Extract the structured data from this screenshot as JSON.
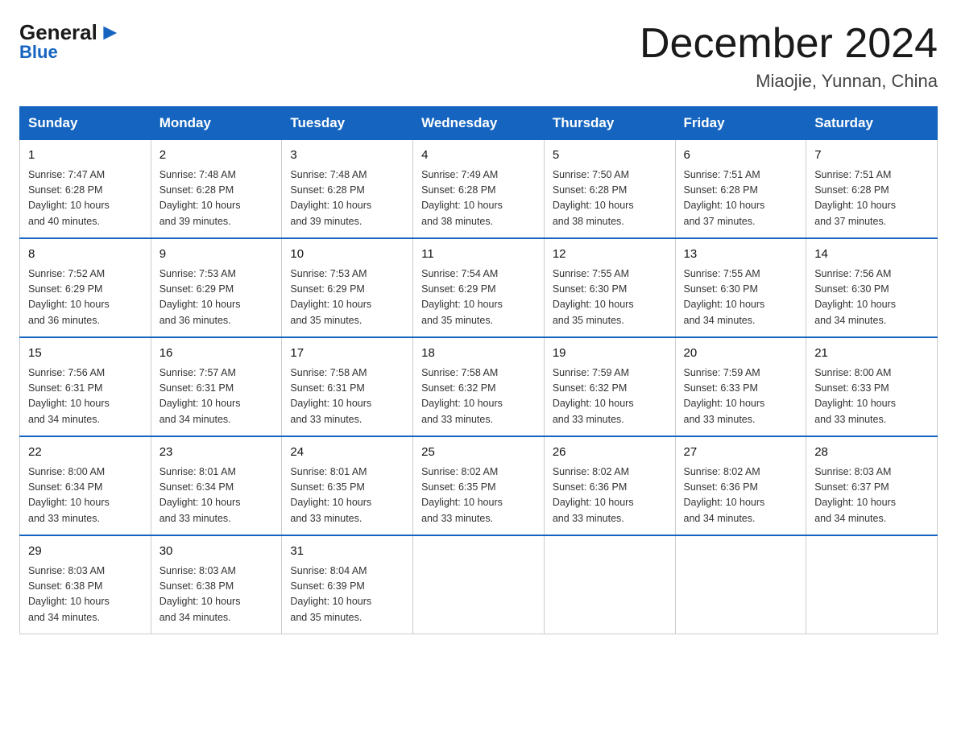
{
  "logo": {
    "general": "General",
    "blue": "Blue",
    "tagline": "Blue"
  },
  "title": {
    "month_year": "December 2024",
    "location": "Miaojie, Yunnan, China"
  },
  "days_of_week": [
    "Sunday",
    "Monday",
    "Tuesday",
    "Wednesday",
    "Thursday",
    "Friday",
    "Saturday"
  ],
  "weeks": [
    [
      {
        "day": "1",
        "sunrise": "7:47 AM",
        "sunset": "6:28 PM",
        "daylight": "10 hours and 40 minutes."
      },
      {
        "day": "2",
        "sunrise": "7:48 AM",
        "sunset": "6:28 PM",
        "daylight": "10 hours and 39 minutes."
      },
      {
        "day": "3",
        "sunrise": "7:48 AM",
        "sunset": "6:28 PM",
        "daylight": "10 hours and 39 minutes."
      },
      {
        "day": "4",
        "sunrise": "7:49 AM",
        "sunset": "6:28 PM",
        "daylight": "10 hours and 38 minutes."
      },
      {
        "day": "5",
        "sunrise": "7:50 AM",
        "sunset": "6:28 PM",
        "daylight": "10 hours and 38 minutes."
      },
      {
        "day": "6",
        "sunrise": "7:51 AM",
        "sunset": "6:28 PM",
        "daylight": "10 hours and 37 minutes."
      },
      {
        "day": "7",
        "sunrise": "7:51 AM",
        "sunset": "6:28 PM",
        "daylight": "10 hours and 37 minutes."
      }
    ],
    [
      {
        "day": "8",
        "sunrise": "7:52 AM",
        "sunset": "6:29 PM",
        "daylight": "10 hours and 36 minutes."
      },
      {
        "day": "9",
        "sunrise": "7:53 AM",
        "sunset": "6:29 PM",
        "daylight": "10 hours and 36 minutes."
      },
      {
        "day": "10",
        "sunrise": "7:53 AM",
        "sunset": "6:29 PM",
        "daylight": "10 hours and 35 minutes."
      },
      {
        "day": "11",
        "sunrise": "7:54 AM",
        "sunset": "6:29 PM",
        "daylight": "10 hours and 35 minutes."
      },
      {
        "day": "12",
        "sunrise": "7:55 AM",
        "sunset": "6:30 PM",
        "daylight": "10 hours and 35 minutes."
      },
      {
        "day": "13",
        "sunrise": "7:55 AM",
        "sunset": "6:30 PM",
        "daylight": "10 hours and 34 minutes."
      },
      {
        "day": "14",
        "sunrise": "7:56 AM",
        "sunset": "6:30 PM",
        "daylight": "10 hours and 34 minutes."
      }
    ],
    [
      {
        "day": "15",
        "sunrise": "7:56 AM",
        "sunset": "6:31 PM",
        "daylight": "10 hours and 34 minutes."
      },
      {
        "day": "16",
        "sunrise": "7:57 AM",
        "sunset": "6:31 PM",
        "daylight": "10 hours and 34 minutes."
      },
      {
        "day": "17",
        "sunrise": "7:58 AM",
        "sunset": "6:31 PM",
        "daylight": "10 hours and 33 minutes."
      },
      {
        "day": "18",
        "sunrise": "7:58 AM",
        "sunset": "6:32 PM",
        "daylight": "10 hours and 33 minutes."
      },
      {
        "day": "19",
        "sunrise": "7:59 AM",
        "sunset": "6:32 PM",
        "daylight": "10 hours and 33 minutes."
      },
      {
        "day": "20",
        "sunrise": "7:59 AM",
        "sunset": "6:33 PM",
        "daylight": "10 hours and 33 minutes."
      },
      {
        "day": "21",
        "sunrise": "8:00 AM",
        "sunset": "6:33 PM",
        "daylight": "10 hours and 33 minutes."
      }
    ],
    [
      {
        "day": "22",
        "sunrise": "8:00 AM",
        "sunset": "6:34 PM",
        "daylight": "10 hours and 33 minutes."
      },
      {
        "day": "23",
        "sunrise": "8:01 AM",
        "sunset": "6:34 PM",
        "daylight": "10 hours and 33 minutes."
      },
      {
        "day": "24",
        "sunrise": "8:01 AM",
        "sunset": "6:35 PM",
        "daylight": "10 hours and 33 minutes."
      },
      {
        "day": "25",
        "sunrise": "8:02 AM",
        "sunset": "6:35 PM",
        "daylight": "10 hours and 33 minutes."
      },
      {
        "day": "26",
        "sunrise": "8:02 AM",
        "sunset": "6:36 PM",
        "daylight": "10 hours and 33 minutes."
      },
      {
        "day": "27",
        "sunrise": "8:02 AM",
        "sunset": "6:36 PM",
        "daylight": "10 hours and 34 minutes."
      },
      {
        "day": "28",
        "sunrise": "8:03 AM",
        "sunset": "6:37 PM",
        "daylight": "10 hours and 34 minutes."
      }
    ],
    [
      {
        "day": "29",
        "sunrise": "8:03 AM",
        "sunset": "6:38 PM",
        "daylight": "10 hours and 34 minutes."
      },
      {
        "day": "30",
        "sunrise": "8:03 AM",
        "sunset": "6:38 PM",
        "daylight": "10 hours and 34 minutes."
      },
      {
        "day": "31",
        "sunrise": "8:04 AM",
        "sunset": "6:39 PM",
        "daylight": "10 hours and 35 minutes."
      },
      null,
      null,
      null,
      null
    ]
  ],
  "labels": {
    "sunrise": "Sunrise:",
    "sunset": "Sunset:",
    "daylight": "Daylight:"
  }
}
